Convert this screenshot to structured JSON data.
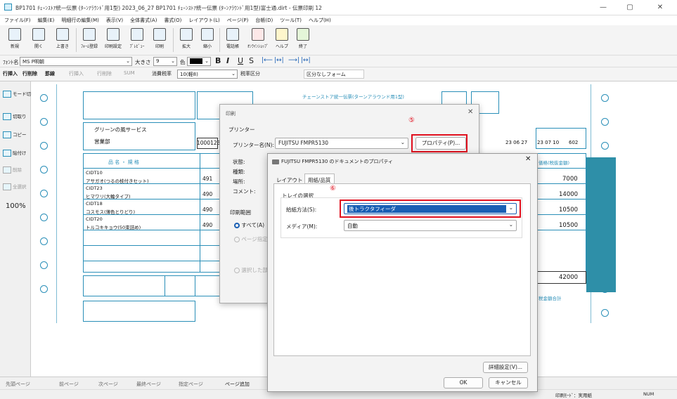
{
  "window": {
    "title": "BP1701 ﾁｪｰﾝｽﾄｱ統一伝票 (ﾀｰﾝｱﾗｳﾝﾄﾞ用1型) 2023_06_27 BP1701 ﾁｪｰﾝｽﾄｱ統一伝票 (ﾀｰﾝｱﾗｳﾝﾄﾞ用1型)富士通.dirt - 伝票印刷 12",
    "minimize": "—",
    "maximize": "▢",
    "close": "✕"
  },
  "menu": [
    "ファイル(F)",
    "編集(E)",
    "明細行の編集(M)",
    "表示(V)",
    "全体書式(A)",
    "書式(O)",
    "レイアウト(L)",
    "ページ(P)",
    "台帳(D)",
    "ツール(T)",
    "ヘルプ(H)"
  ],
  "toolbar": [
    {
      "label": "新規",
      "icon": "new-file-icon"
    },
    {
      "label": "開く",
      "icon": "open-folder-icon"
    },
    {
      "label": "上書き",
      "icon": "save-icon"
    },
    {
      "label": "ﾌｫｰﾑ登録",
      "icon": "form-register-icon"
    },
    {
      "label": "印刷設定",
      "icon": "print-settings-icon"
    },
    {
      "label": "ﾌﾟﾚﾋﾞｭｰ",
      "icon": "preview-icon"
    },
    {
      "label": "印刷",
      "icon": "printer-icon"
    },
    {
      "label": "拡大",
      "icon": "zoom-in-icon"
    },
    {
      "label": "縮小",
      "icon": "zoom-out-icon"
    },
    {
      "label": "電話帳",
      "icon": "phonebook-icon"
    },
    {
      "label": "ｵﾝﾗｲﾝｼｮｯﾌﾟ",
      "icon": "online-shop-icon"
    },
    {
      "label": "ヘルプ",
      "icon": "help-icon"
    },
    {
      "label": "終了",
      "icon": "exit-icon"
    }
  ],
  "toolbar2": {
    "font_label": "ﾌｫﾝﾄ名",
    "font_value": "MS P明朝",
    "size_label": "大きさ",
    "size_value": "9",
    "color_label": "色",
    "bold": "B",
    "italic": "I",
    "underline": "U",
    "strike": "S"
  },
  "toolbar3": {
    "item1": "行挿入",
    "item2": "行削除",
    "item3": "罫線",
    "item4": "行挿入",
    "item5": "行削除",
    "item6": "SUM",
    "tax_label": "消費税率",
    "tax_value": "10(軽8)",
    "tax_type": "税率区分",
    "form_value": "区分なしフォーム"
  },
  "leftpanel": [
    "モード切替",
    "切取り",
    "コピー",
    "貼付け",
    "削除",
    "全選択",
    "100%"
  ],
  "form": {
    "header_title": "チェーンストア統一伝票(ターンアラウンド用1型)",
    "company": "グリーンの風サービス",
    "dept": "営業部",
    "code": "1000123",
    "col_item": "品 名 ・ 規 格",
    "col_total": "価格(税抜金額)",
    "rows": [
      {
        "code": "CIDT10",
        "name": "アサガオ(つるの枝付きセット)",
        "num": "491",
        "price": "7000"
      },
      {
        "code": "CIDT23",
        "name": "ヒマワリ(大輪タイプ)",
        "num": "490",
        "price": "14000"
      },
      {
        "code": "CIDT18",
        "name": "コスモス(薄色とりどり)",
        "num": "490",
        "price": "10500"
      },
      {
        "code": "CIDT20",
        "name": "トルコキキョウ(50束詰め)",
        "num": "490",
        "price": "10500"
      }
    ],
    "total": "42000",
    "date1": "23 06 27",
    "date2": "23 07 10",
    "code2": "602",
    "label_sub": "税金額合計"
  },
  "bottombar": [
    "先頭ページ",
    "前ページ",
    "次ページ",
    "最終ページ",
    "指定ページ",
    "ページ追加"
  ],
  "statusbar": {
    "mode": "印刷ﾓｰﾄﾞ：実用紙",
    "num": "NUM"
  },
  "print_dialog": {
    "title": "印刷",
    "printer_group": "プリンター",
    "printer_name_label": "プリンター名(N):",
    "printer_name": "FUJITSU FMPR5130",
    "properties_button": "プロパティ(P)...",
    "status_label": "状態:",
    "type_label": "種類:",
    "where_label": "場所:",
    "comment_label": "コメント:",
    "range_label": "印刷範囲",
    "all_label": "すべて(A)",
    "page_label": "ページ指定",
    "selection_label": "選択した部分",
    "step_number": "⑤"
  },
  "props_dialog": {
    "title": "FUJITSU FMPR5130 のドキュメントのプロパティ",
    "tab_layout": "レイアウト",
    "tab_paper": "用紙/品質",
    "tray_group": "トレイの選択",
    "feed_label": "給紙方法(S):",
    "feed_value": "後トラクタフィーダ",
    "media_label": "メディア(M):",
    "media_value": "自動",
    "advanced_button": "詳細設定(V)...",
    "ok_button": "OK",
    "cancel_button": "キャンセル",
    "step_number": "⑥"
  }
}
